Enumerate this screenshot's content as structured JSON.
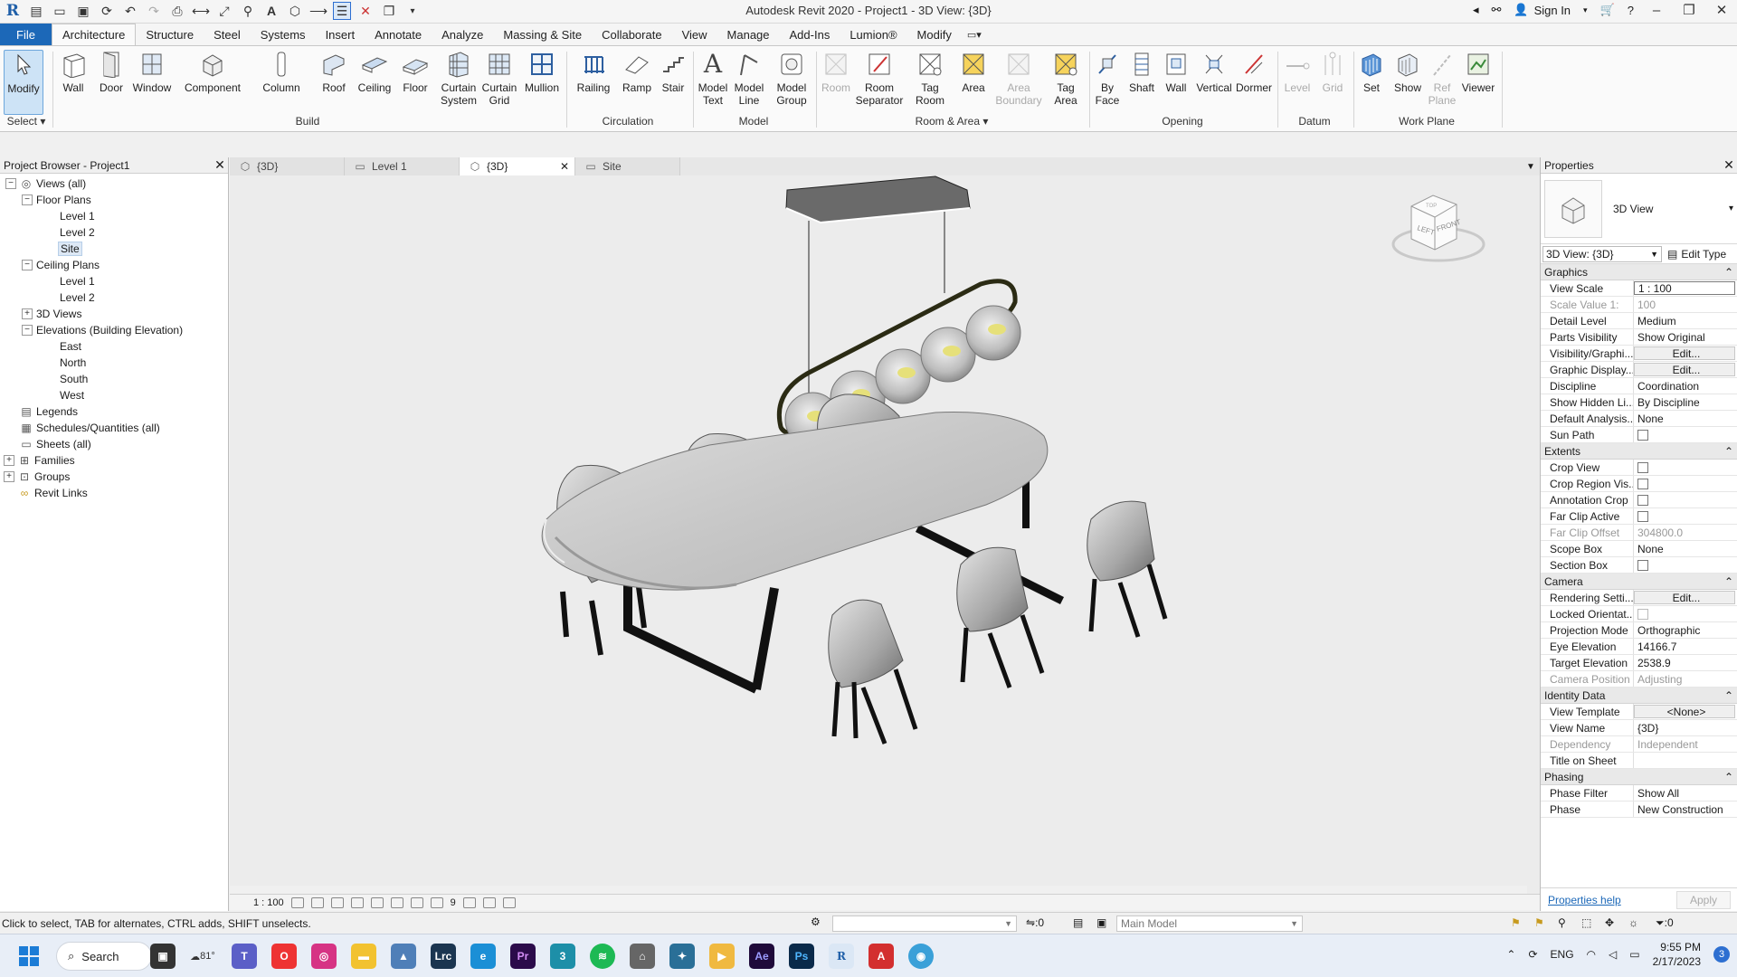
{
  "window": {
    "title": "Autodesk Revit 2020 - Project1 - 3D View: {3D}",
    "sign_in": "Sign In"
  },
  "ribbon_tabs": [
    "File",
    "Architecture",
    "Structure",
    "Steel",
    "Systems",
    "Insert",
    "Annotate",
    "Analyze",
    "Massing & Site",
    "Collaborate",
    "View",
    "Manage",
    "Add-Ins",
    "Lumion®",
    "Modify"
  ],
  "ribbon": {
    "modify": "Modify",
    "select_panel": "Select",
    "build_panel": "Build",
    "circulation_panel": "Circulation",
    "model_panel": "Model",
    "room_area_panel": "Room & Area",
    "opening_panel": "Opening",
    "datum_panel": "Datum",
    "workplane_panel": "Work Plane",
    "tools": {
      "wall": "Wall",
      "door": "Door",
      "window": "Window",
      "component": "Component",
      "column": "Column",
      "roof": "Roof",
      "ceiling": "Ceiling",
      "floor": "Floor",
      "curtain_system_1": "Curtain",
      "curtain_system_2": "System",
      "curtain_grid_1": "Curtain",
      "curtain_grid_2": "Grid",
      "mullion": "Mullion",
      "railing": "Railing",
      "ramp": "Ramp",
      "stair": "Stair",
      "model_text_1": "Model",
      "model_text_2": "Text",
      "model_line_1": "Model",
      "model_line_2": "Line",
      "model_group_1": "Model",
      "model_group_2": "Group",
      "room": "Room",
      "room_sep_1": "Room",
      "room_sep_2": "Separator",
      "tag_room_1": "Tag",
      "tag_room_2": "Room",
      "area": "Area",
      "area_boundary_1": "Area",
      "area_boundary_2": "Boundary",
      "tag_area_1": "Tag",
      "tag_area_2": "Area",
      "by_face_1": "By",
      "by_face_2": "Face",
      "shaft": "Shaft",
      "wall_op": "Wall",
      "vertical": "Vertical",
      "dormer": "Dormer",
      "level": "Level",
      "grid": "Grid",
      "set": "Set",
      "show": "Show",
      "ref_plane_1": "Ref",
      "ref_plane_2": "Plane",
      "viewer": "Viewer"
    }
  },
  "project_browser": {
    "title": "Project Browser - Project1",
    "nodes": [
      {
        "label": "Views (all)",
        "toggle": "−"
      },
      {
        "label": "Floor Plans",
        "toggle": "−"
      },
      {
        "label": "Level 1"
      },
      {
        "label": "Level 2"
      },
      {
        "label": "Site"
      },
      {
        "label": "Ceiling Plans",
        "toggle": "−"
      },
      {
        "label": "Level 1"
      },
      {
        "label": "Level 2"
      },
      {
        "label": "3D Views",
        "toggle": "+"
      },
      {
        "label": "Elevations (Building Elevation)",
        "toggle": "−"
      },
      {
        "label": "East"
      },
      {
        "label": "North"
      },
      {
        "label": "South"
      },
      {
        "label": "West"
      },
      {
        "label": "Legends"
      },
      {
        "label": "Schedules/Quantities (all)"
      },
      {
        "label": "Sheets (all)"
      },
      {
        "label": "Families",
        "toggle": "+"
      },
      {
        "label": "Groups",
        "toggle": "+"
      },
      {
        "label": "Revit Links"
      }
    ]
  },
  "view_tabs": [
    {
      "label": "{3D}"
    },
    {
      "label": "Level 1"
    },
    {
      "label": "{3D}",
      "active": true
    },
    {
      "label": "Site"
    }
  ],
  "view_control_bar": {
    "scale": "1 : 100",
    "nine": "9"
  },
  "view_cube": {
    "left": "LEFT",
    "front": "FRONT",
    "top": "TOP"
  },
  "properties": {
    "title": "Properties",
    "type_name": "3D View",
    "instance": "3D View: {3D}",
    "edit_type": "Edit Type",
    "groups": [
      {
        "name": "Graphics",
        "rows": [
          {
            "k": "View Scale",
            "v": "1 : 100",
            "style": "box"
          },
          {
            "k": "Scale Value    1:",
            "v": "100",
            "style": "ro"
          },
          {
            "k": "Detail Level",
            "v": "Medium"
          },
          {
            "k": "Parts Visibility",
            "v": "Show Original"
          },
          {
            "k": "Visibility/Graphi...",
            "v": "Edit...",
            "style": "btn"
          },
          {
            "k": "Graphic Display...",
            "v": "Edit...",
            "style": "btn"
          },
          {
            "k": "Discipline",
            "v": "Coordination"
          },
          {
            "k": "Show Hidden Li...",
            "v": "By Discipline"
          },
          {
            "k": "Default Analysis...",
            "v": "None"
          },
          {
            "k": "Sun Path",
            "v": "",
            "style": "cb"
          }
        ]
      },
      {
        "name": "Extents",
        "rows": [
          {
            "k": "Crop View",
            "v": "",
            "style": "cb"
          },
          {
            "k": "Crop Region Vis...",
            "v": "",
            "style": "cb"
          },
          {
            "k": "Annotation Crop",
            "v": "",
            "style": "cb"
          },
          {
            "k": "Far Clip Active",
            "v": "",
            "style": "cb"
          },
          {
            "k": "Far Clip Offset",
            "v": "304800.0",
            "style": "ro"
          },
          {
            "k": "Scope Box",
            "v": "None"
          },
          {
            "k": "Section Box",
            "v": "",
            "style": "cb"
          }
        ]
      },
      {
        "name": "Camera",
        "rows": [
          {
            "k": "Rendering Setti...",
            "v": "Edit...",
            "style": "btn"
          },
          {
            "k": "Locked Orientat...",
            "v": "",
            "style": "cbro"
          },
          {
            "k": "Projection Mode",
            "v": "Orthographic"
          },
          {
            "k": "Eye Elevation",
            "v": "14166.7"
          },
          {
            "k": "Target Elevation",
            "v": "2538.9"
          },
          {
            "k": "Camera Position",
            "v": "Adjusting",
            "style": "ro"
          }
        ]
      },
      {
        "name": "Identity Data",
        "rows": [
          {
            "k": "View Template",
            "v": "<None>",
            "style": "btn"
          },
          {
            "k": "View Name",
            "v": "{3D}"
          },
          {
            "k": "Dependency",
            "v": "Independent",
            "style": "ro"
          },
          {
            "k": "Title on Sheet",
            "v": ""
          }
        ]
      },
      {
        "name": "Phasing",
        "rows": [
          {
            "k": "Phase Filter",
            "v": "Show All"
          },
          {
            "k": "Phase",
            "v": "New Construction"
          }
        ]
      }
    ],
    "help": "Properties help",
    "apply": "Apply"
  },
  "status": {
    "message": "Click to select, TAB for alternates, CTRL adds, SHIFT unselects.",
    "zero": ":0",
    "model": "Main Model",
    "filter": ":0"
  },
  "taskbar": {
    "search": "Search",
    "weather": "81°",
    "lang": "ENG",
    "time": "9:55 PM",
    "date": "2/17/2023",
    "notifications": "3"
  }
}
